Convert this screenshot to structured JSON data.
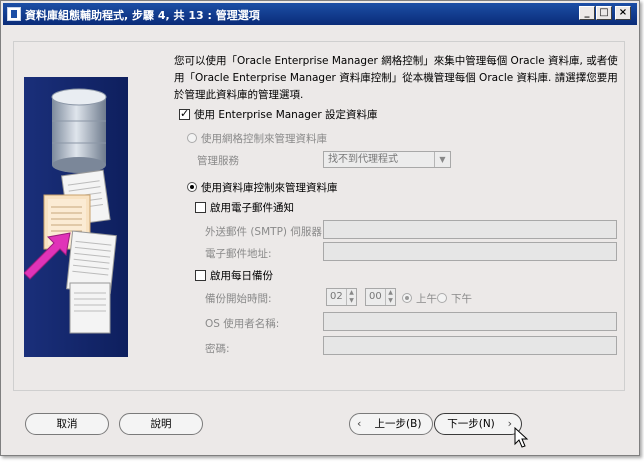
{
  "window": {
    "title": "資料庫組態輔助程式, 步驟 4, 共 13 : 管理選項",
    "min_label": "_",
    "max_label": "□",
    "close_label": "×"
  },
  "description": "您可以使用「Oracle Enterprise Manager 網格控制」來集中管理每個 Oracle 資料庫, 或者使用「Oracle Enterprise Manager 資料庫控制」從本機管理每個 Oracle 資料庫. 請選擇您要用於管理此資料庫的管理選項.",
  "options": {
    "use_em": "使用 Enterprise Manager 設定資料庫",
    "grid_control": "使用網格控制來管理資料庫",
    "mgmt_service_label": "管理服務",
    "mgmt_service_value": "找不到代理程式",
    "db_control": "使用資料庫控制來管理資料庫",
    "enable_email": "啟用電子郵件通知",
    "smtp_label": "外送郵件 (SMTP) 伺服器:",
    "email_label": "電子郵件地址:",
    "enable_backup": "啟用每日備份",
    "backup_time_label": "備份開始時間:",
    "backup_hour": "02",
    "backup_minute": "00",
    "am_label": "上午",
    "pm_label": "下午",
    "os_user_label": "OS 使用者名稱:",
    "password_label": "密碼:"
  },
  "buttons": {
    "cancel": "取消",
    "help": "說明",
    "back": "上一步(B)",
    "next": "下一步(N)"
  },
  "colors": {
    "title_bar": "#0a2b78",
    "panel_art": "#1a2f7a"
  }
}
